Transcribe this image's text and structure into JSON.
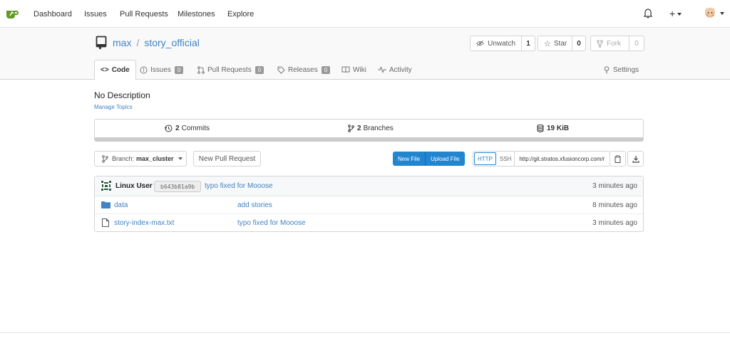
{
  "nav": {
    "items": [
      "Dashboard",
      "Issues",
      "Pull Requests",
      "Milestones",
      "Explore"
    ]
  },
  "repo": {
    "owner": "max",
    "separator": "/",
    "name": "story_official",
    "watch_label": "Unwatch",
    "watch_count": "1",
    "star_label": "Star",
    "star_count": "0",
    "fork_label": "Fork",
    "fork_count": "0"
  },
  "tabs": [
    {
      "label": "Code"
    },
    {
      "label": "Issues",
      "badge": "0"
    },
    {
      "label": "Pull Requests",
      "badge": "0"
    },
    {
      "label": "Releases",
      "badge": "0"
    },
    {
      "label": "Wiki"
    },
    {
      "label": "Activity"
    },
    {
      "label": "Settings"
    }
  ],
  "description": "No Description",
  "manage_topics": "Manage Topics",
  "stats": {
    "commits_count": "2",
    "commits_label": "Commits",
    "branches_count": "2",
    "branches_label": "Branches",
    "size": "19 KiB"
  },
  "actions": {
    "branch_prefix": "Branch:",
    "branch_name": "max_cluster",
    "new_pr": "New Pull Request",
    "new_file": "New File",
    "upload_file": "Upload File",
    "http": "HTTP",
    "ssh": "SSH",
    "clone_url": "http://git.stratos.xfusioncorp.com/r"
  },
  "latest_commit": {
    "author": "Linux User",
    "sha": "b643b81a9b",
    "message": "typo fixed for Mooose",
    "age": "3 minutes ago"
  },
  "files": [
    {
      "name": "data",
      "type": "folder",
      "message": "add stories",
      "age": "8 minutes ago"
    },
    {
      "name": "story-index-max.txt",
      "type": "file",
      "message": "typo fixed for Mooose",
      "age": "3 minutes ago"
    }
  ],
  "colors": {
    "accent": "#2185d0",
    "link": "#4183c4",
    "logo": "#609926"
  },
  "icons": [
    "gitea-logo-icon",
    "bell-icon",
    "plus-icon",
    "avatar",
    "repo-book-icon",
    "eye-slash-icon",
    "star-icon",
    "fork-icon",
    "code-icon",
    "issue-icon",
    "pull-request-icon",
    "tag-icon",
    "wiki-icon",
    "pulse-icon",
    "tools-icon",
    "history-icon",
    "branch-icon",
    "database-icon",
    "clipboard-icon",
    "download-icon",
    "folder-icon",
    "file-icon"
  ]
}
